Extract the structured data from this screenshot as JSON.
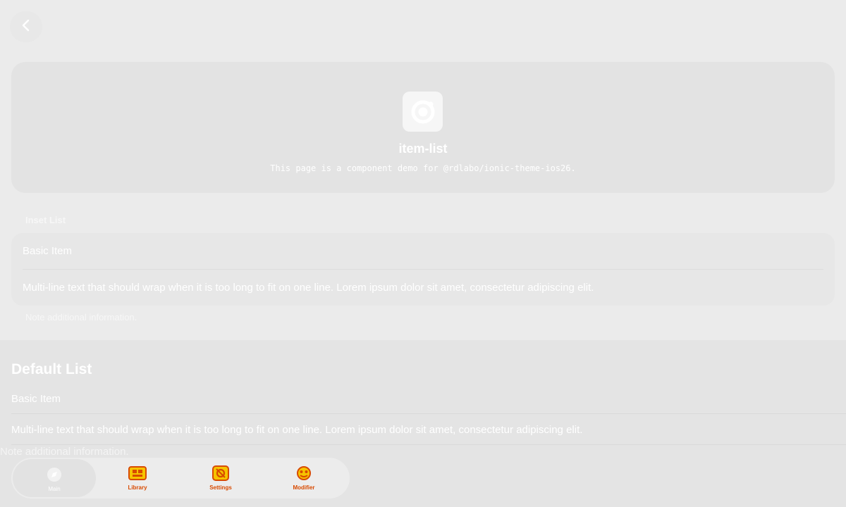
{
  "hero": {
    "title": "item-list",
    "subtitle": "This page is a component demo for @rdlabo/ionic-theme-ios26."
  },
  "inset_list": {
    "header": "Inset List",
    "items": [
      {
        "label": "Basic Item"
      },
      {
        "label": "Multi-line text that should wrap when it is too long to fit on one line. Lorem ipsum dolor sit amet, consectetur adipiscing elit."
      }
    ],
    "note": "Note additional information."
  },
  "default_list": {
    "title": "Default List",
    "items": [
      {
        "label": "Basic Item"
      },
      {
        "label": "Multi-line text that should wrap when it is too long to fit on one line. Lorem ipsum dolor sit amet, consectetur adipiscing elit."
      }
    ],
    "note": "Note additional information."
  },
  "tab_bar": {
    "tabs": [
      {
        "label": "Main",
        "icon": "compass-icon",
        "active": true
      },
      {
        "label": "Library",
        "icon": "library-icon",
        "active": false
      },
      {
        "label": "Settings",
        "icon": "settings-icon",
        "active": false
      },
      {
        "label": "Modifier",
        "icon": "modifier-icon",
        "active": false
      }
    ]
  },
  "colors": {
    "background": "#ebebeb",
    "card": "#e3e3e3",
    "text": "#ffffff",
    "tab_accent": "#d84a00",
    "tab_accent_yellow": "#f6c400"
  }
}
